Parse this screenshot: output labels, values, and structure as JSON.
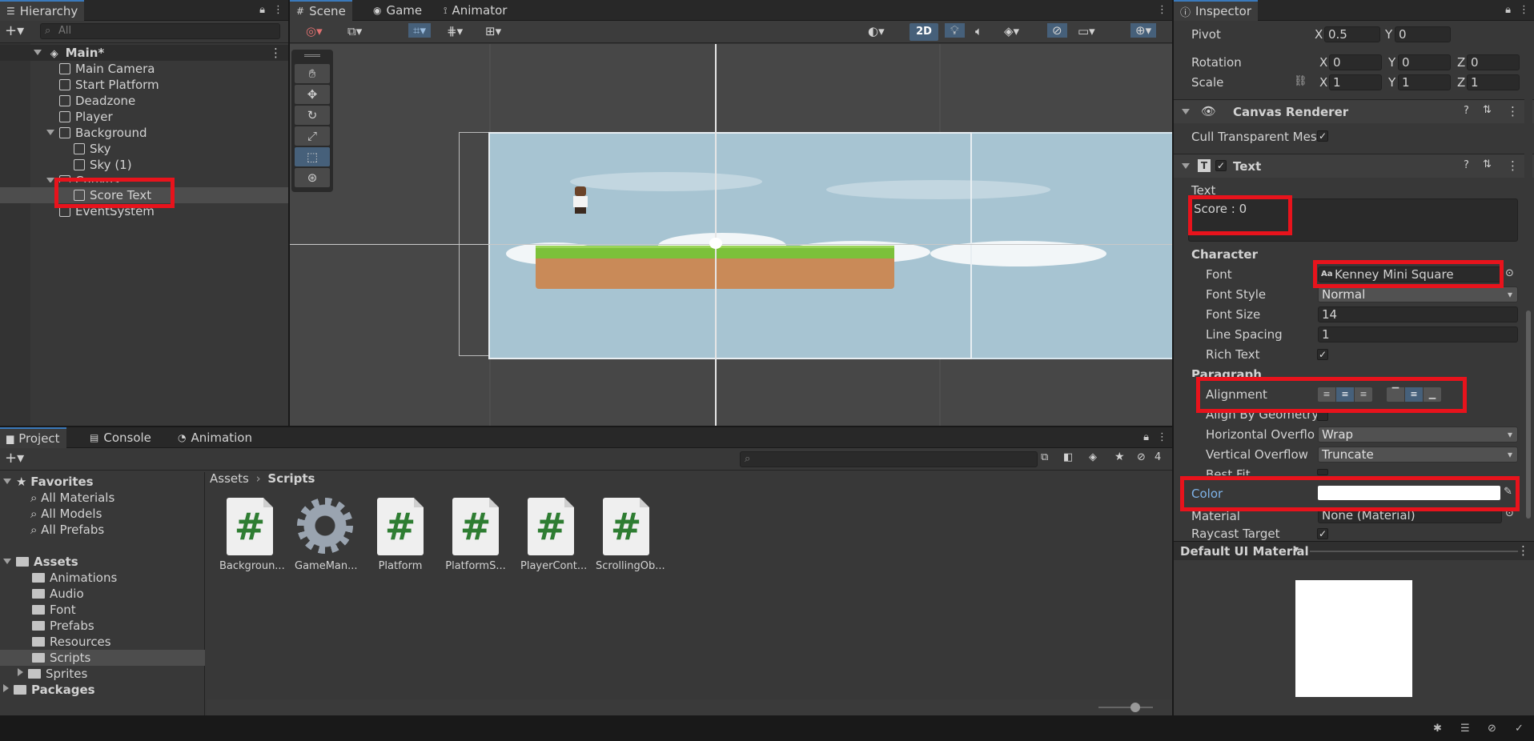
{
  "hierarchy": {
    "tab": "Hierarchy",
    "search_placeholder": "All",
    "scene": "Main*",
    "items": [
      "Main Camera",
      "Start Platform",
      "Deadzone",
      "Player",
      "Background",
      "Sky",
      "Sky (1)",
      "Canvas",
      "Score Text",
      "EventSystem"
    ]
  },
  "scene_view": {
    "tabs": [
      "Scene",
      "Game",
      "Animator"
    ],
    "toggle_2d": "2D"
  },
  "inspector": {
    "tab": "Inspector",
    "pivot": {
      "label": "Pivot",
      "x": "0.5",
      "y": "0"
    },
    "rotation": {
      "label": "Rotation",
      "x": "0",
      "y": "0",
      "z": "0"
    },
    "scale": {
      "label": "Scale",
      "x": "1",
      "y": "1",
      "z": "1"
    },
    "canvas_renderer": {
      "title": "Canvas Renderer",
      "cull_label": "Cull Transparent Mes"
    },
    "text_component": {
      "title": "Text",
      "text_label": "Text",
      "text_value": "Score : 0",
      "character_header": "Character",
      "font_label": "Font",
      "font_value": "Kenney Mini Square",
      "font_style_label": "Font Style",
      "font_style_value": "Normal",
      "font_size_label": "Font Size",
      "font_size_value": "14",
      "line_spacing_label": "Line Spacing",
      "line_spacing_value": "1",
      "rich_text_label": "Rich Text",
      "paragraph_header": "Paragraph",
      "alignment_label": "Alignment",
      "align_geometry_label": "Align By Geometry",
      "h_overflow_label": "Horizontal Overflov",
      "h_overflow_value": "Wrap",
      "v_overflow_label": "Vertical Overflow",
      "v_overflow_value": "Truncate",
      "best_fit_label": "Best Fit",
      "color_label": "Color",
      "color_value": "#ffffff",
      "material_label": "Material",
      "material_value": "None (Material)",
      "raycast_label": "Raycast Target"
    },
    "material_preview_title": "Default UI Material"
  },
  "project": {
    "tabs": [
      "Project",
      "Console",
      "Animation"
    ],
    "favorites_label": "Favorites",
    "favorites": [
      "All Materials",
      "All Models",
      "All Prefabs"
    ],
    "assets_label": "Assets",
    "asset_folders": [
      "Animations",
      "Audio",
      "Font",
      "Prefabs",
      "Resources",
      "Scripts",
      "Sprites"
    ],
    "packages_label": "Packages",
    "breadcrumb": [
      "Assets",
      "Scripts"
    ],
    "files": [
      "Backgroun...",
      "GameMan...",
      "Platform",
      "PlatformS...",
      "PlayerCont...",
      "ScrollingOb..."
    ],
    "hidden_count": "4"
  },
  "colors": {
    "accent": "#3a79bb",
    "annotation": "#e8131c",
    "sky": "#a7c4d2",
    "grass": "#7cc13a",
    "dirt": "#c98a58"
  }
}
